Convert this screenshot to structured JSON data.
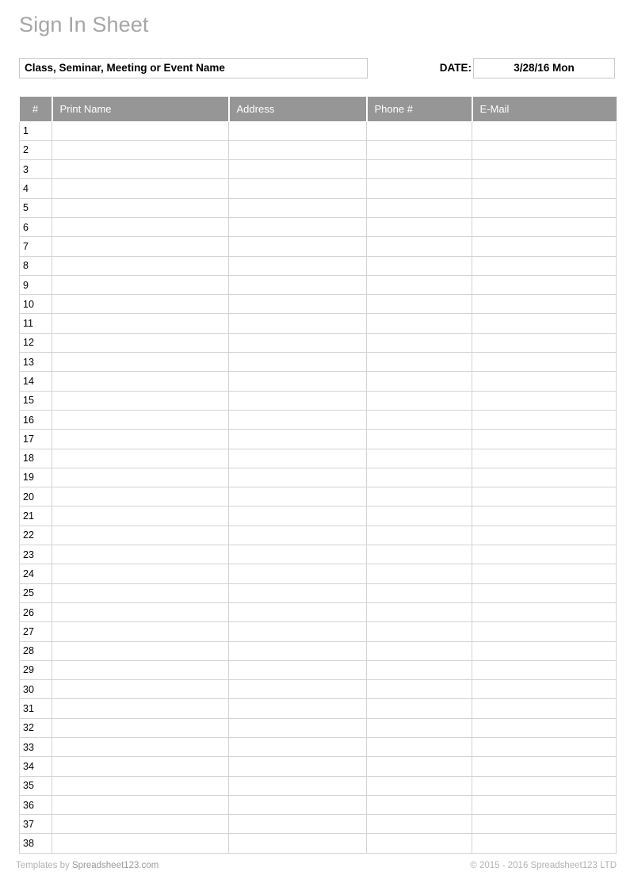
{
  "document": {
    "title": "Sign In Sheet"
  },
  "header": {
    "event_name_value": "Class, Seminar, Meeting or Event Name",
    "event_name_placeholder": "Class, Seminar, Meeting or Event Name",
    "date_label": "DATE:",
    "date_value": "3/28/16 Mon",
    "date_placeholder": "3/28/16 Mon"
  },
  "table": {
    "columns": [
      {
        "key": "num",
        "label": "#"
      },
      {
        "key": "name",
        "label": "Print Name"
      },
      {
        "key": "addr",
        "label": "Address"
      },
      {
        "key": "phone",
        "label": "Phone #"
      },
      {
        "key": "mail",
        "label": "E-Mail"
      }
    ],
    "row_count": 38,
    "rows": [
      {
        "num": "1",
        "name": "",
        "addr": "",
        "phone": "",
        "mail": ""
      },
      {
        "num": "2",
        "name": "",
        "addr": "",
        "phone": "",
        "mail": ""
      },
      {
        "num": "3",
        "name": "",
        "addr": "",
        "phone": "",
        "mail": ""
      },
      {
        "num": "4",
        "name": "",
        "addr": "",
        "phone": "",
        "mail": ""
      },
      {
        "num": "5",
        "name": "",
        "addr": "",
        "phone": "",
        "mail": ""
      },
      {
        "num": "6",
        "name": "",
        "addr": "",
        "phone": "",
        "mail": ""
      },
      {
        "num": "7",
        "name": "",
        "addr": "",
        "phone": "",
        "mail": ""
      },
      {
        "num": "8",
        "name": "",
        "addr": "",
        "phone": "",
        "mail": ""
      },
      {
        "num": "9",
        "name": "",
        "addr": "",
        "phone": "",
        "mail": ""
      },
      {
        "num": "10",
        "name": "",
        "addr": "",
        "phone": "",
        "mail": ""
      },
      {
        "num": "11",
        "name": "",
        "addr": "",
        "phone": "",
        "mail": ""
      },
      {
        "num": "12",
        "name": "",
        "addr": "",
        "phone": "",
        "mail": ""
      },
      {
        "num": "13",
        "name": "",
        "addr": "",
        "phone": "",
        "mail": ""
      },
      {
        "num": "14",
        "name": "",
        "addr": "",
        "phone": "",
        "mail": ""
      },
      {
        "num": "15",
        "name": "",
        "addr": "",
        "phone": "",
        "mail": ""
      },
      {
        "num": "16",
        "name": "",
        "addr": "",
        "phone": "",
        "mail": ""
      },
      {
        "num": "17",
        "name": "",
        "addr": "",
        "phone": "",
        "mail": ""
      },
      {
        "num": "18",
        "name": "",
        "addr": "",
        "phone": "",
        "mail": ""
      },
      {
        "num": "19",
        "name": "",
        "addr": "",
        "phone": "",
        "mail": ""
      },
      {
        "num": "20",
        "name": "",
        "addr": "",
        "phone": "",
        "mail": ""
      },
      {
        "num": "21",
        "name": "",
        "addr": "",
        "phone": "",
        "mail": ""
      },
      {
        "num": "22",
        "name": "",
        "addr": "",
        "phone": "",
        "mail": ""
      },
      {
        "num": "23",
        "name": "",
        "addr": "",
        "phone": "",
        "mail": ""
      },
      {
        "num": "24",
        "name": "",
        "addr": "",
        "phone": "",
        "mail": ""
      },
      {
        "num": "25",
        "name": "",
        "addr": "",
        "phone": "",
        "mail": ""
      },
      {
        "num": "26",
        "name": "",
        "addr": "",
        "phone": "",
        "mail": ""
      },
      {
        "num": "27",
        "name": "",
        "addr": "",
        "phone": "",
        "mail": ""
      },
      {
        "num": "28",
        "name": "",
        "addr": "",
        "phone": "",
        "mail": ""
      },
      {
        "num": "29",
        "name": "",
        "addr": "",
        "phone": "",
        "mail": ""
      },
      {
        "num": "30",
        "name": "",
        "addr": "",
        "phone": "",
        "mail": ""
      },
      {
        "num": "31",
        "name": "",
        "addr": "",
        "phone": "",
        "mail": ""
      },
      {
        "num": "32",
        "name": "",
        "addr": "",
        "phone": "",
        "mail": ""
      },
      {
        "num": "33",
        "name": "",
        "addr": "",
        "phone": "",
        "mail": ""
      },
      {
        "num": "34",
        "name": "",
        "addr": "",
        "phone": "",
        "mail": ""
      },
      {
        "num": "35",
        "name": "",
        "addr": "",
        "phone": "",
        "mail": ""
      },
      {
        "num": "36",
        "name": "",
        "addr": "",
        "phone": "",
        "mail": ""
      },
      {
        "num": "37",
        "name": "",
        "addr": "",
        "phone": "",
        "mail": ""
      },
      {
        "num": "38",
        "name": "",
        "addr": "",
        "phone": "",
        "mail": ""
      }
    ]
  },
  "footer": {
    "left_prefix": "Templates by ",
    "left_brand": "Spreadsheet123.com",
    "right": "© 2015 - 2016 Spreadsheet123 LTD"
  },
  "colors": {
    "header_gray": "#969696",
    "title_gray": "#a6a6a6",
    "grid_line": "#d4d4d4",
    "field_border": "#c9c9c9",
    "footer_gray": "#b3b3b3"
  }
}
